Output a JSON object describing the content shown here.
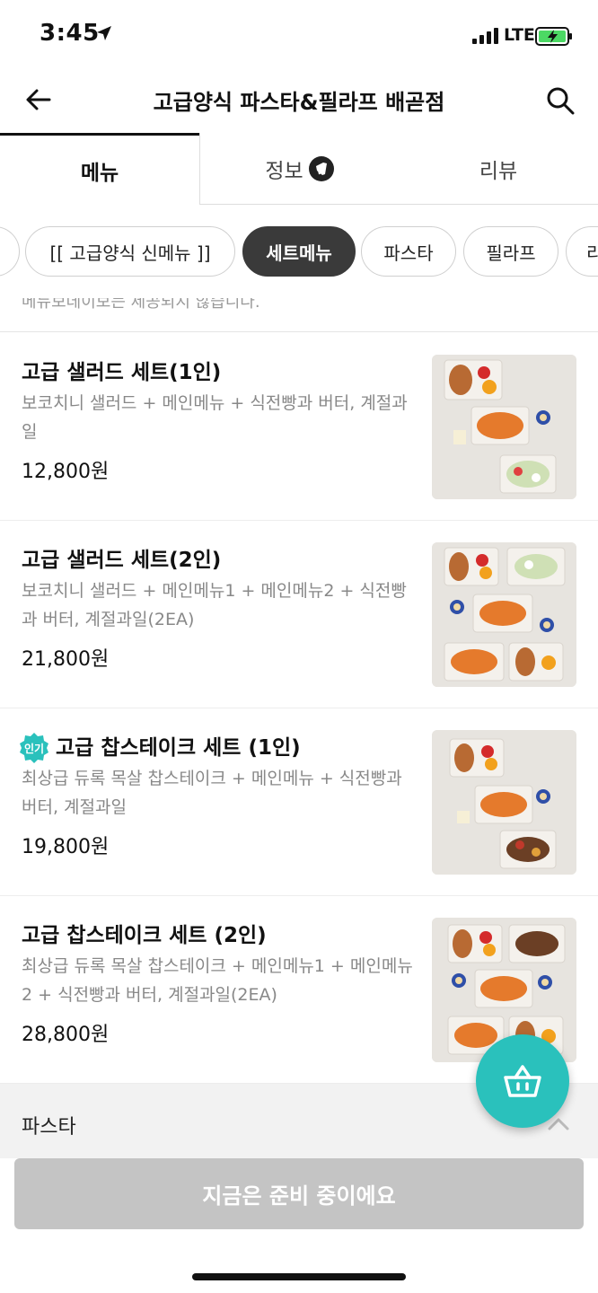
{
  "status": {
    "time": "3:45",
    "network": "LTE"
  },
  "header": {
    "title": "고급양식 파스타&필라프 배곧점"
  },
  "tabs": [
    {
      "label": "메뉴"
    },
    {
      "label": "정보"
    },
    {
      "label": "리뷰"
    }
  ],
  "categories": [
    {
      "label": "[[ 고급양식 신메뉴 ]]"
    },
    {
      "label": "세트메뉴"
    },
    {
      "label": "파스타"
    },
    {
      "label": "필라프"
    },
    {
      "label": "리"
    }
  ],
  "cut_notice": "메뉴보데이보는 제공되지 않습니다.",
  "menu_items": [
    {
      "name": "고급 샐러드 세트(1인)",
      "desc": "보코치니 샐러드 + 메인메뉴 + 식전빵과 버터, 계절과일",
      "price": "12,800원",
      "badge": ""
    },
    {
      "name": "고급 샐러드 세트(2인)",
      "desc": "보코치니 샐러드 + 메인메뉴1 + 메인메뉴2 + 식전빵과 버터, 계절과일(2EA)",
      "price": "21,800원",
      "badge": ""
    },
    {
      "name": "고급 찹스테이크 세트 (1인)",
      "desc": "최상급 듀록 목살 찹스테이크 + 메인메뉴 + 식전빵과 버터, 계절과일",
      "price": "19,800원",
      "badge": "인기"
    },
    {
      "name": "고급 찹스테이크 세트 (2인)",
      "desc": "최상급 듀록 목살 찹스테이크 + 메인메뉴1 + 메인메뉴2 + 식전빵과 버터, 계절과일(2EA)",
      "price": "28,800원",
      "badge": ""
    }
  ],
  "section": {
    "title": "파스타"
  },
  "bottom": {
    "button_label": "지금은 준비 중이에요"
  },
  "colors": {
    "accent": "#2ac1bc",
    "active_chip": "#3a3a3a",
    "disabled_button": "#c4c4c4"
  }
}
